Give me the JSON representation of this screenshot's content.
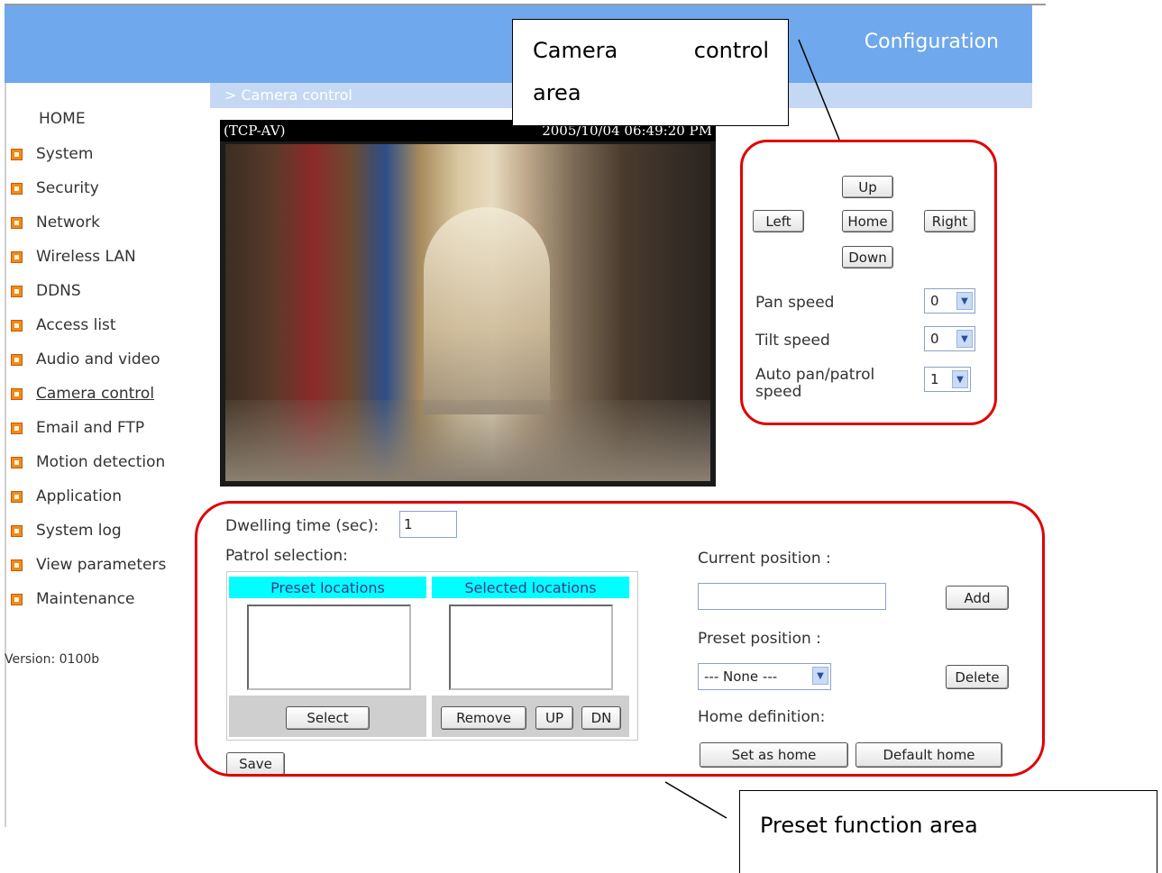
{
  "header": {
    "title": "Configuration",
    "breadcrumb": "> Camera control"
  },
  "sidebar": {
    "home": "HOME",
    "items": [
      {
        "label": "System"
      },
      {
        "label": "Security"
      },
      {
        "label": "Network"
      },
      {
        "label": "Wireless LAN"
      },
      {
        "label": "DDNS"
      },
      {
        "label": "Access list"
      },
      {
        "label": "Audio and video"
      },
      {
        "label": "Camera control",
        "active": true
      },
      {
        "label": "Email and FTP"
      },
      {
        "label": "Motion detection"
      },
      {
        "label": "Application"
      },
      {
        "label": "System log"
      },
      {
        "label": "View parameters"
      },
      {
        "label": "Maintenance"
      }
    ],
    "version": "Version: 0100b"
  },
  "video": {
    "source": "(TCP-AV)",
    "timestamp": "2005/10/04 06:49:20 PM"
  },
  "camera_control": {
    "up": "Up",
    "left": "Left",
    "home": "Home",
    "right": "Right",
    "down": "Down",
    "pan_speed_label": "Pan speed",
    "pan_speed_value": "0",
    "tilt_speed_label": "Tilt speed",
    "tilt_speed_value": "0",
    "auto_pan_label_1": "Auto pan/patrol",
    "auto_pan_label_2": "speed",
    "auto_pan_value": "1"
  },
  "preset": {
    "dwelling_label": "Dwelling time (sec):",
    "dwelling_value": "1",
    "patrol_label": "Patrol selection:",
    "preset_locations": "Preset locations",
    "selected_locations": "Selected locations",
    "select": "Select",
    "remove": "Remove",
    "up": "UP",
    "dn": "DN",
    "save": "Save",
    "current_position_label": "Current position :",
    "current_position_value": "",
    "add": "Add",
    "preset_position_label": "Preset position :",
    "preset_position_value": "--- None ---",
    "delete": "Delete",
    "home_definition_label": "Home definition:",
    "set_as_home": "Set as home",
    "default_home": "Default home"
  },
  "annotations": {
    "camera_callout_1": "Camera control",
    "camera_callout_2": "area",
    "preset_callout": "Preset function area",
    "ring_color": "#e00000"
  }
}
